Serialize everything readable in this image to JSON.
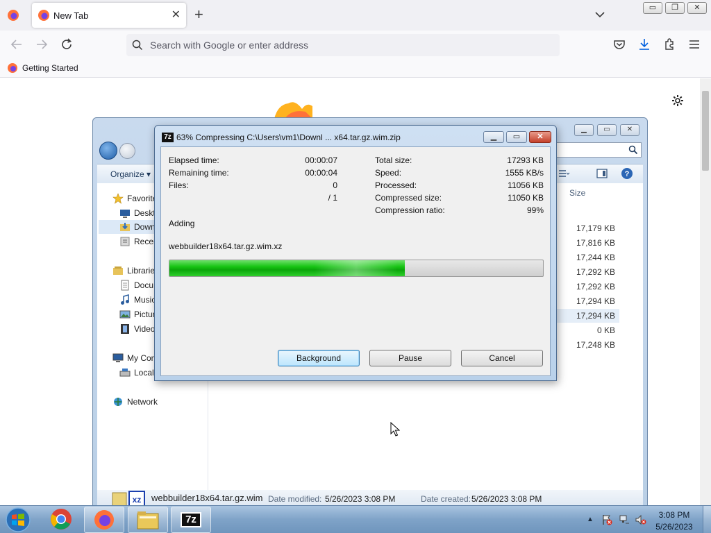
{
  "browser": {
    "tab_title": "New Tab",
    "url_placeholder": "Search with Google or enter address",
    "bookmark": "Getting Started"
  },
  "explorer": {
    "organize": "Organize ▾",
    "nav_items": [
      "Favorite",
      "Deskt",
      "Down",
      "Recen",
      "Librarie",
      "Docu",
      "Music",
      "Pictur",
      "Video",
      "My Con",
      "Local",
      "Network"
    ],
    "column_size": "Size",
    "sizes": [
      "17,179 KB",
      "17,816 KB",
      "17,244 KB",
      "17,292 KB",
      "17,292 KB",
      "17,294 KB",
      "17,294 KB",
      "0 KB",
      "17,248 KB"
    ],
    "status": {
      "filename": "webbuilder18x64.tar.gz.wim",
      "modified_label": "Date modified:",
      "modified_value": "5/26/2023 3:08 PM",
      "created_label": "Date created:",
      "created_value": "5/26/2023 3:08 PM"
    }
  },
  "dialog": {
    "icon_text": "7z",
    "title": "63% Compressing C:\\Users\\vm1\\Downl ... x64.tar.gz.wim.zip",
    "left_stats": [
      {
        "label": "Elapsed time:",
        "value": "00:00:07"
      },
      {
        "label": "Remaining time:",
        "value": "00:00:04"
      },
      {
        "label": "Files:",
        "value": "0"
      },
      {
        "label": "",
        "value": "/ 1"
      }
    ],
    "right_stats": [
      {
        "label": "Total size:",
        "value": "17293 KB"
      },
      {
        "label": "Speed:",
        "value": "1555 KB/s"
      },
      {
        "label": "Processed:",
        "value": "11056 KB"
      },
      {
        "label": "Compressed size:",
        "value": "11050 KB"
      },
      {
        "label": "Compression ratio:",
        "value": "99%"
      }
    ],
    "operation": "Adding",
    "current_file": "webbuilder18x64.tar.gz.wim.xz",
    "progress_percent": 63,
    "buttons": {
      "background": "Background",
      "pause": "Pause",
      "cancel": "Cancel"
    }
  },
  "taskbar": {
    "clock_time": "3:08 PM",
    "clock_date": "5/26/2023",
    "sevenzip_label": "7z"
  },
  "colors": {
    "progress_green": "#17c414",
    "firefox_orange": "#ff7139",
    "firefox_purple": "#7542e5"
  }
}
